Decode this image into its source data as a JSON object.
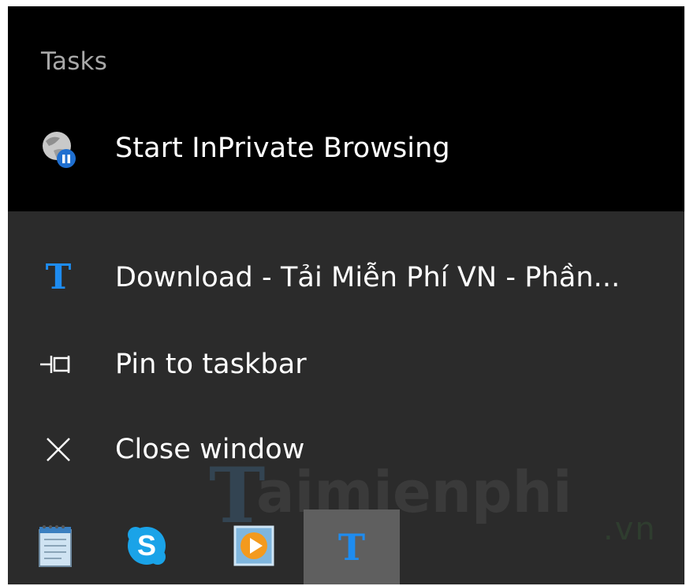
{
  "jump_list": {
    "tasks_heading": "Tasks",
    "inprivate_label": "Start InPrivate Browsing",
    "inprivate_icon": "inprivate-globe-icon",
    "download_label": "Download - Tải Miễn Phí VN - Phần...",
    "download_icon_glyph": "T",
    "pin_label": "Pin to taskbar",
    "pin_icon": "pin-icon",
    "close_label": "Close window",
    "close_icon": "close-icon"
  },
  "watermark": {
    "brand_main": "aimienphi",
    "brand_initial": "T",
    "brand_suffix": ".vn"
  },
  "taskbar": {
    "items": [
      {
        "name": "notepad",
        "icon": "notepad-icon"
      },
      {
        "name": "skype",
        "icon": "skype-icon",
        "glyph": "S"
      },
      {
        "name": "media-player",
        "icon": "media-player-icon"
      },
      {
        "name": "taimienphi-browser",
        "icon": "t-icon",
        "glyph": "T",
        "active": true
      }
    ]
  },
  "colors": {
    "tasks_bg": "#000000",
    "menu_bg": "#2b2b2b",
    "accent_blue": "#1e8cf0",
    "text": "#ffffff",
    "heading_text": "#a8a8a8",
    "active_taskbar": "#5f5f5f"
  }
}
